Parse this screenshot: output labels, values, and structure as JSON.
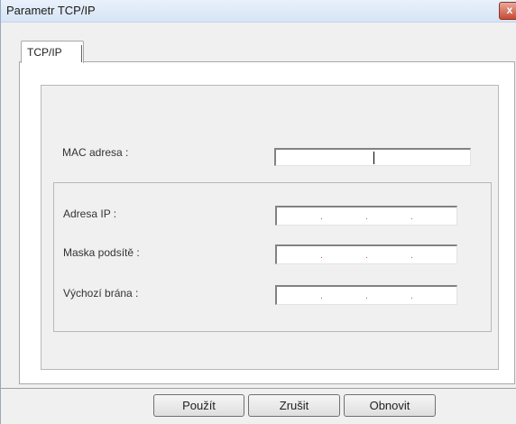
{
  "window": {
    "title": "Parametr TCP/IP",
    "close_glyph": "x"
  },
  "tabs": [
    {
      "label": "TCP/IP",
      "selected": true
    }
  ],
  "fields": {
    "mac": {
      "label": "MAC adresa :",
      "value": ""
    },
    "ip_group": {
      "ip_address": {
        "label": "Adresa IP :",
        "separator": "."
      },
      "subnet_mask": {
        "label": "Maska podsítě :",
        "separator": "."
      },
      "default_gateway": {
        "label": "Výchozí brána :",
        "separator": "."
      }
    }
  },
  "buttons": {
    "apply": "Použít",
    "cancel": "Zrušit",
    "restore": "Obnovit"
  },
  "colors": {
    "titlebar": "#d6e4f5",
    "close_button": "#c84a35",
    "ip_dot": "#d23a3a",
    "dialog_bg": "#f0f0f0"
  }
}
